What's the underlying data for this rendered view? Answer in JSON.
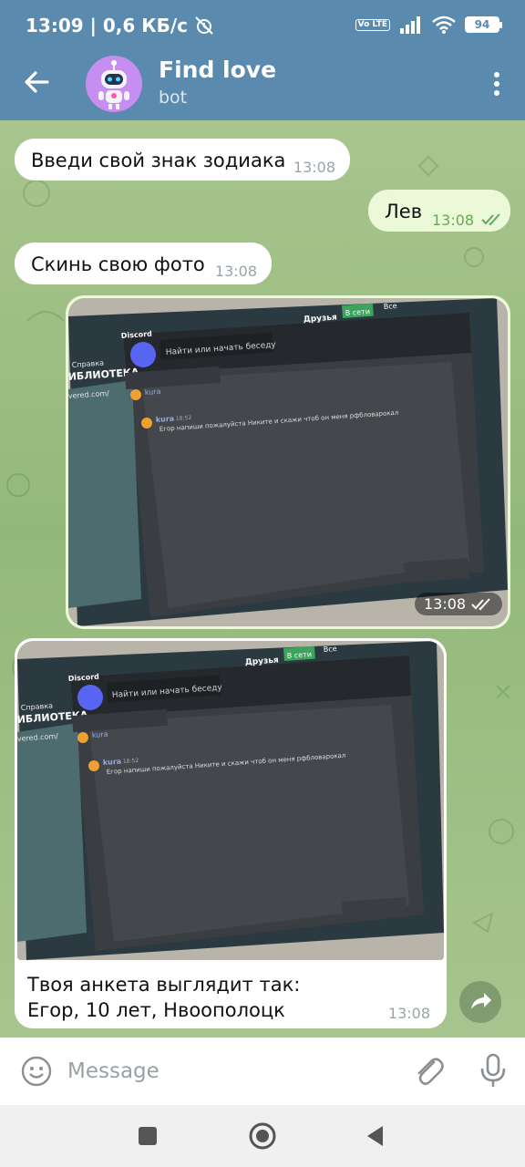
{
  "status_bar": {
    "time_speed": "13:09 | 0,6 КБ/с",
    "lte": "Vo LTE",
    "battery": "94"
  },
  "header": {
    "title": "Find love",
    "subtitle": "bot"
  },
  "messages": [
    {
      "direction": "in",
      "text": "Введи свой знак зодиака",
      "time": "13:08"
    },
    {
      "direction": "out",
      "text": "Лев",
      "time": "13:08"
    },
    {
      "direction": "in",
      "text": "Скинь свою фото",
      "time": "13:08"
    },
    {
      "direction": "out",
      "type": "photo",
      "time": "13:08"
    },
    {
      "direction": "in",
      "type": "photo",
      "caption_line1": "Твоя анкета выглядит так:",
      "caption_line2": "Егор, 10 лет, Нвоополоцк",
      "time": "13:08"
    }
  ],
  "photo_content": {
    "app": "Discord",
    "search": "Найти или начать беседу",
    "friends": "Друзья",
    "online": "В сети",
    "all": "Все",
    "user": "kura",
    "msg_time": "18:52",
    "msg_text": "Егор напиши пожалуйста Никите и скажи чтоб он меня рфбловарокал",
    "library": "ИБЛИОТЕКА",
    "help": "Справка",
    "site": "vered.com/"
  },
  "input": {
    "placeholder": "Message"
  },
  "colors": {
    "header": "#5a8aae",
    "incoming": "#ffffff",
    "outgoing": "#ecf9d9",
    "time_out": "#66a85a"
  }
}
